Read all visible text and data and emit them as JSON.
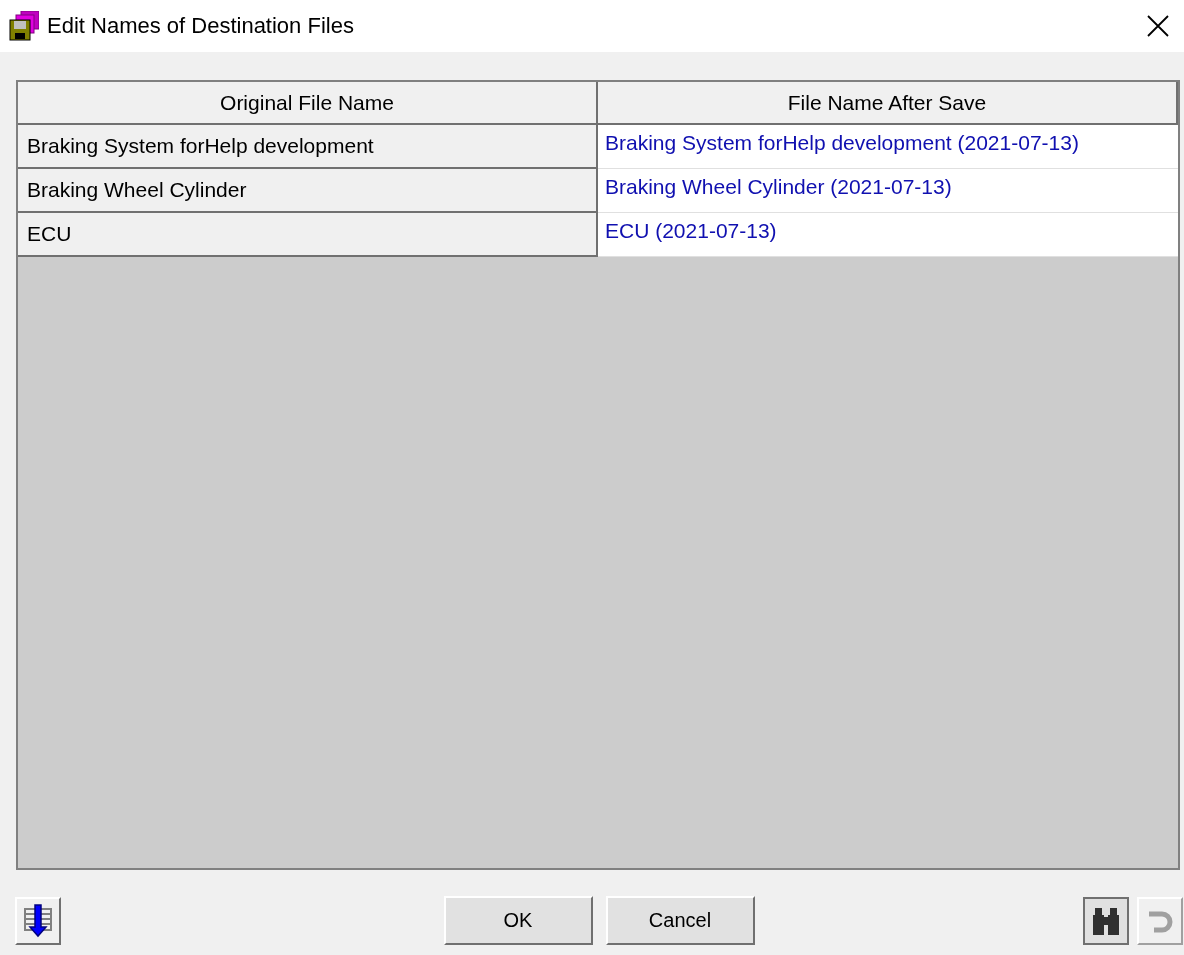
{
  "window": {
    "title": "Edit Names of Destination Files"
  },
  "table": {
    "columns": [
      "Original File Name",
      "File Name After Save"
    ],
    "rows": [
      {
        "original": "Braking System forHelp development",
        "after_save": "Braking System forHelp development (2021-07-13)"
      },
      {
        "original": "Braking Wheel Cylinder",
        "after_save": "Braking Wheel Cylinder (2021-07-13)"
      },
      {
        "original": "ECU",
        "after_save": "ECU (2021-07-13)"
      }
    ]
  },
  "buttons": [
    {
      "label": "OK"
    },
    {
      "label": "Cancel"
    }
  ],
  "tools": [
    {
      "kind": "find",
      "disabled": false
    },
    {
      "kind": "undo",
      "disabled": true
    }
  ]
}
